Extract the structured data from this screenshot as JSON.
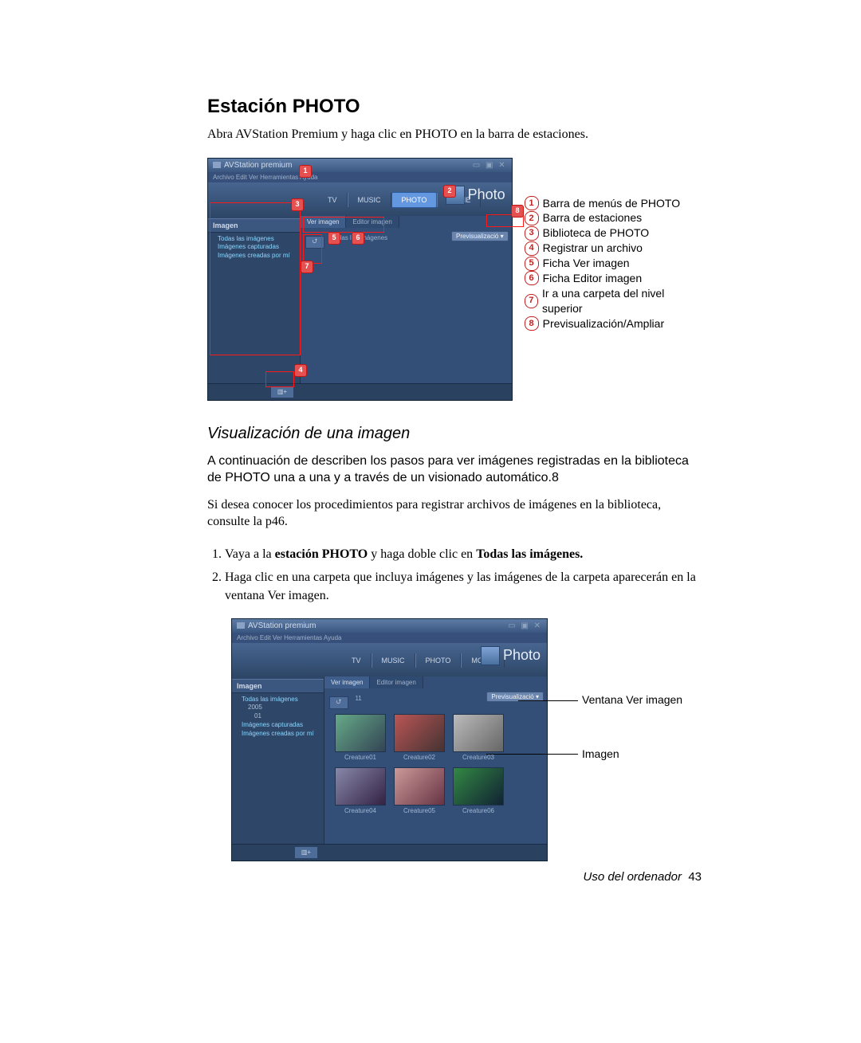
{
  "section_title": "Estación PHOTO",
  "intro": "Abra AVStation Premium y haga clic en PHOTO en la barra de estaciones.",
  "app": {
    "title": "AVStation premium",
    "menubar": "Archivo  Edit  Ver  Herramientas  Ayuda",
    "stations": {
      "tv": "TV",
      "music": "MUSIC",
      "photo": "PHOTO",
      "movie": "MOVIE"
    },
    "station_label": "Photo",
    "sidebar_header": "Imagen",
    "tree": {
      "all": "Todas las imágenes",
      "captured": "Imágenes capturadas",
      "mine": "Imágenes creadas por mí",
      "year": "2005",
      "month": "01"
    },
    "tabs": {
      "view": "Ver imagen",
      "edit": "Editor imagen"
    },
    "breadcrumb_label": "Todas las imágenes",
    "preview_drop": "Previsualizació",
    "up_icon_name": "folder-up-icon",
    "register_icon_name": "register-file-icon",
    "thumbs_count_label": "11",
    "thumbs": [
      "Creature01",
      "Creature02",
      "Creature03",
      "Creature04",
      "Creature05",
      "Creature06"
    ]
  },
  "legend": [
    "Barra de menús de PHOTO",
    "Barra de estaciones",
    "Biblioteca de PHOTO",
    "Registrar un archivo",
    "Ficha Ver imagen",
    "Ficha Editor imagen",
    "Ir a una carpeta del nivel superior",
    "Previsualización/Ampliar"
  ],
  "subsection_title": "Visualización de una imagen",
  "sub_p1": "A continuación de describen los pasos para ver imágenes registradas en la biblioteca de PHOTO una a una y a través de un visionado automático.8",
  "sub_p2": "Si desea conocer los procedimientos para registrar archivos de imágenes en la biblioteca, consulte la p46.",
  "steps": {
    "s1_prefix": "Vaya a la ",
    "s1_bold_a": "estación PHOTO",
    "s1_mid": " y haga doble clic en ",
    "s1_bold_b": "Todas las imágenes.",
    "s2": "Haga clic en una carpeta que incluya imágenes y las imágenes de la carpeta aparecerán en la ventana Ver imagen."
  },
  "callouts": {
    "view_window": "Ventana Ver imagen",
    "image": "Imagen"
  },
  "footer_label": "Uso del ordenador",
  "footer_page": "43"
}
